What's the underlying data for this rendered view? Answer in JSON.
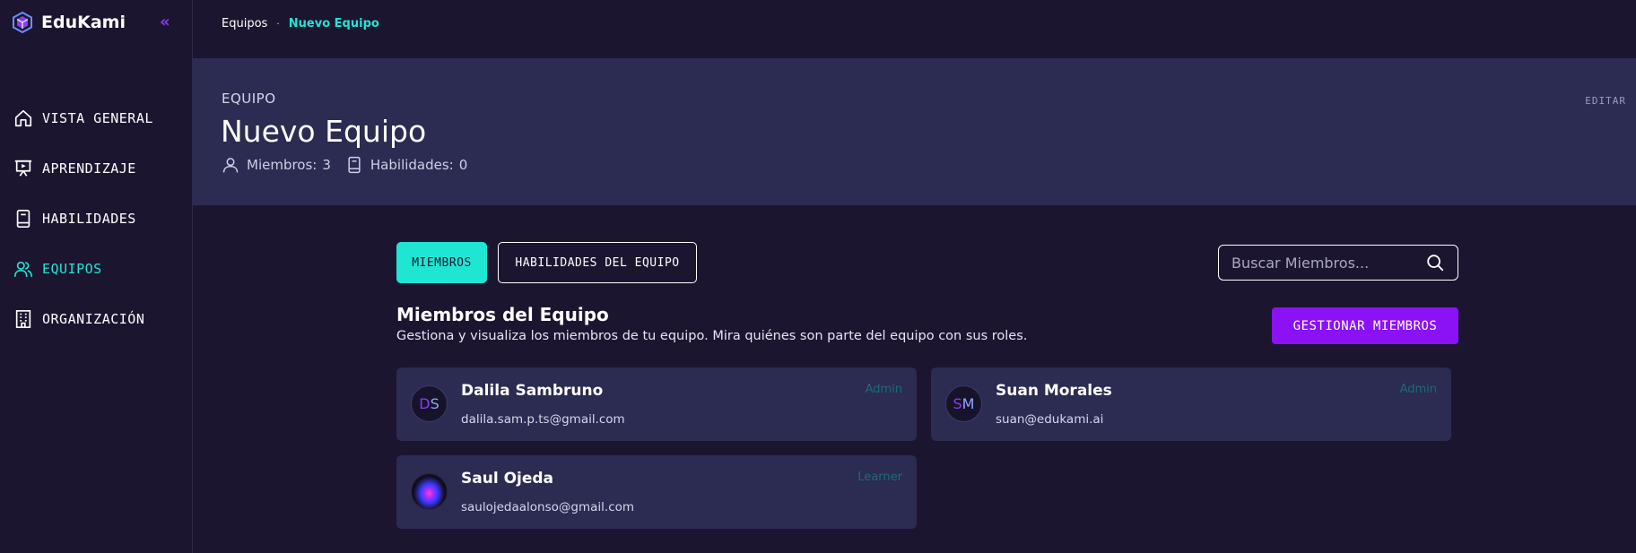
{
  "sidebar": {
    "brand": "EduKami",
    "collapse_label": "«",
    "items": [
      {
        "label": "VISTA GENERAL",
        "icon": "home-icon"
      },
      {
        "label": "APRENDIZAJE",
        "icon": "presentation-icon"
      },
      {
        "label": "HABILIDADES",
        "icon": "book-icon"
      },
      {
        "label": "EQUIPOS",
        "icon": "users-icon",
        "active": true
      },
      {
        "label": "ORGANIZACIÓN",
        "icon": "building-icon"
      }
    ]
  },
  "breadcrumb": {
    "items": [
      "Equipos",
      "Nuevo Equipo"
    ],
    "separator": "·"
  },
  "hero": {
    "kicker": "EQUIPO",
    "title": "Nuevo Equipo",
    "members_label": "Miembros:",
    "members_count": "3",
    "skills_label": "Habilidades:",
    "skills_count": "0",
    "edit_label": "EDITAR"
  },
  "tabs": [
    {
      "label": "MIEMBROS",
      "active": true
    },
    {
      "label": "HABILIDADES DEL EQUIPO",
      "active": false
    }
  ],
  "search": {
    "placeholder": "Buscar Miembros..."
  },
  "section": {
    "title": "Miembros del Equipo",
    "subtitle": "Gestiona y visualiza los miembros de tu equipo. Mira quiénes son parte del equipo con sus roles.",
    "manage_label": "GESTIONAR MIEMBROS"
  },
  "members": [
    {
      "initial_1": "D",
      "initial_2": "S",
      "name": "Dalila Sambruno",
      "email": "dalila.sam.p.ts@gmail.com",
      "role": "Admin"
    },
    {
      "initial_1": "S",
      "initial_2": "M",
      "name": "Suan Morales",
      "email": "suan@edukami.ai",
      "role": "Admin"
    },
    {
      "name": "Saul Ojeda",
      "email": "saulojedaalonso@gmail.com",
      "role": "Learner"
    }
  ],
  "colors": {
    "background": "#1c1530",
    "panel": "#2c2b52",
    "accent_teal": "#1fe6d3",
    "accent_purple": "#8a12f5"
  }
}
